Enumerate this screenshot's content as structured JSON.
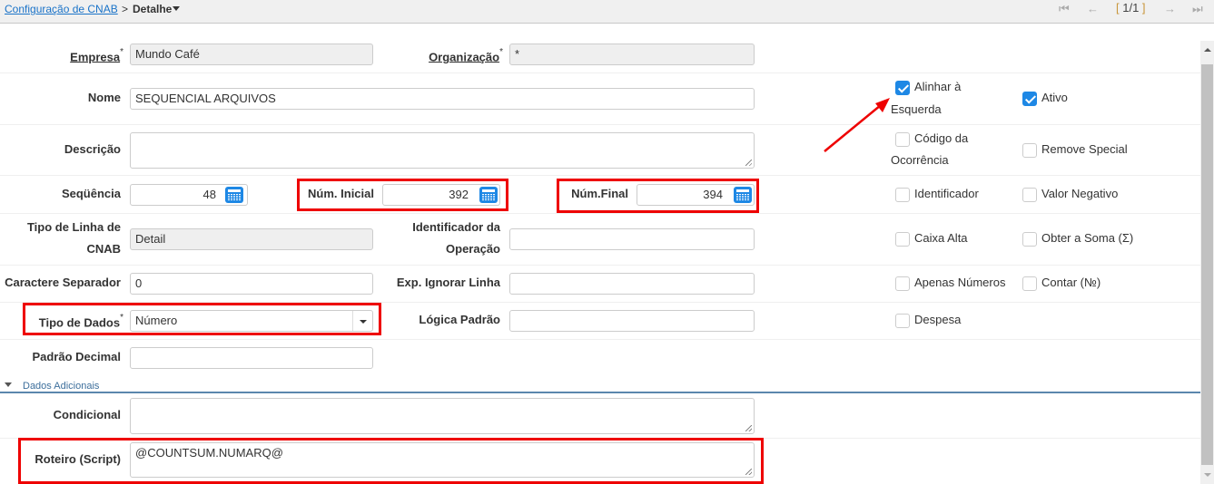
{
  "breadcrumb": {
    "parent": "Configuração de CNAB",
    "separator": ">",
    "current": "Detalhe"
  },
  "pager": {
    "first_icon": "⏮",
    "prev_icon": "←",
    "open": "[",
    "position": " 1/1 ",
    "close": "]",
    "next_icon": "→",
    "last_icon": "⏭"
  },
  "fields": {
    "empresa": {
      "label": "Empresa",
      "required": "*",
      "value": "Mundo Café"
    },
    "organizacao": {
      "label": "Organização",
      "required": "*",
      "value": "*"
    },
    "nome": {
      "label": "Nome",
      "value": "SEQUENCIAL ARQUIVOS"
    },
    "descricao": {
      "label": "Descrição",
      "value": ""
    },
    "sequencia": {
      "label": "Seqüência",
      "value": "48"
    },
    "num_inicial": {
      "label": "Núm. Inicial",
      "value": "392"
    },
    "num_final": {
      "label": "Núm.Final",
      "value": "394"
    },
    "tipo_linha": {
      "label_line1": "Tipo de Linha de",
      "label_line2": "CNAB",
      "value": "Detail"
    },
    "identificador_operacao": {
      "label_line1": "Identificador da",
      "label_line2": "Operação",
      "value": ""
    },
    "caractere_separador": {
      "label": "Caractere Separador",
      "value": "0"
    },
    "exp_ignorar_linha": {
      "label": "Exp. Ignorar Linha",
      "value": ""
    },
    "tipo_dados": {
      "label": "Tipo de Dados",
      "required": "*",
      "value": "Número"
    },
    "logica_padrao": {
      "label": "Lógica Padrão",
      "value": ""
    },
    "padrao_decimal": {
      "label": "Padrão Decimal",
      "value": ""
    },
    "condicional": {
      "label": "Condicional",
      "value": ""
    },
    "roteiro": {
      "label": "Roteiro (Script)",
      "value": "@COUNTSUM.NUMARQ@"
    }
  },
  "checkboxes": {
    "alinhar": {
      "line1": "Alinhar à",
      "line2": "Esquerda",
      "checked": true
    },
    "ativo": {
      "label": "Ativo",
      "checked": true
    },
    "codigo_ocorrencia": {
      "line1": "Código da",
      "line2": "Ocorrência",
      "checked": false
    },
    "remove_special": {
      "label": "Remove Special",
      "checked": false
    },
    "identificador": {
      "label": "Identificador",
      "checked": false
    },
    "valor_negativo": {
      "label": "Valor Negativo",
      "checked": false
    },
    "caixa_alta": {
      "label": "Caixa Alta",
      "checked": false
    },
    "obter_soma": {
      "label": "Obter a Soma (Σ)",
      "checked": false
    },
    "apenas_numeros": {
      "label": "Apenas Números",
      "checked": false
    },
    "contar": {
      "label": "Contar (№)",
      "checked": false
    },
    "despesa": {
      "label": "Despesa",
      "checked": false
    }
  },
  "section": {
    "label": "Dados Adicionais"
  },
  "annotation_color": "#e00000"
}
